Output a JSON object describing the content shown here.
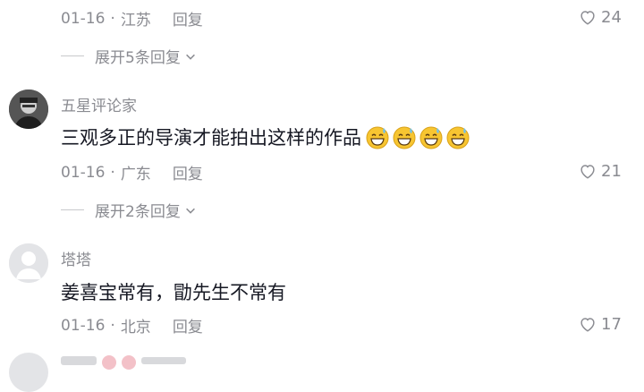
{
  "comments": [
    {
      "date": "01-16",
      "location": "江苏",
      "reply_label": "回复",
      "likes": "24",
      "expand_text": "展开5条回复"
    },
    {
      "username": "五星评论家",
      "text": "三观多正的导演才能拍出这样的作品",
      "emoji_icon": "grinning-sweat-emoji",
      "emoji_count": 4,
      "date": "01-16",
      "location": "广东",
      "reply_label": "回复",
      "likes": "21",
      "expand_text": "展开2条回复"
    },
    {
      "username": "塔塔",
      "text": "姜喜宝常有，勖先生不常有",
      "date": "01-16",
      "location": "北京",
      "reply_label": "回复",
      "likes": "17"
    }
  ],
  "colors": {
    "text_primary": "#161823",
    "text_secondary": "#8a8b91",
    "emoji_yellow": "#f7c531"
  }
}
